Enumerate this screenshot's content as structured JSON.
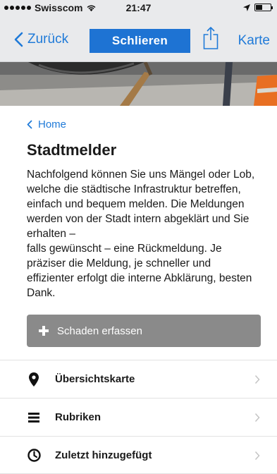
{
  "status_bar": {
    "carrier": "Swisscom",
    "time": "21:47"
  },
  "nav": {
    "back_label": "Zurück",
    "title": "Schlieren",
    "map_label": "Karte",
    "accent_color": "#1f7ad8",
    "title_bg_color": "#1e73d3",
    "icons": [
      "chevron-left-icon",
      "share-icon"
    ]
  },
  "content": {
    "breadcrumb": "Home",
    "title": "Stadtmelder",
    "intro": "Nachfolgend können Sie uns Mängel oder Lob, welche die städtische Infrastruktur betreffen, einfach und bequem melden. Die Meldungen werden von der Stadt intern abgeklärt und Sie erhalten –\nfalls gewünscht – eine Rückmeldung. Je präziser die Meldung, je schneller und effizienter erfolgt die interne Abklärung, besten Dank.",
    "report_button": "Schaden erfassen"
  },
  "menu": {
    "items": [
      {
        "label": "Übersichtskarte",
        "icon": "map-pin-icon"
      },
      {
        "label": "Rubriken",
        "icon": "list-icon"
      },
      {
        "label": "Zuletzt hinzugefügt",
        "icon": "clock-icon"
      }
    ]
  }
}
